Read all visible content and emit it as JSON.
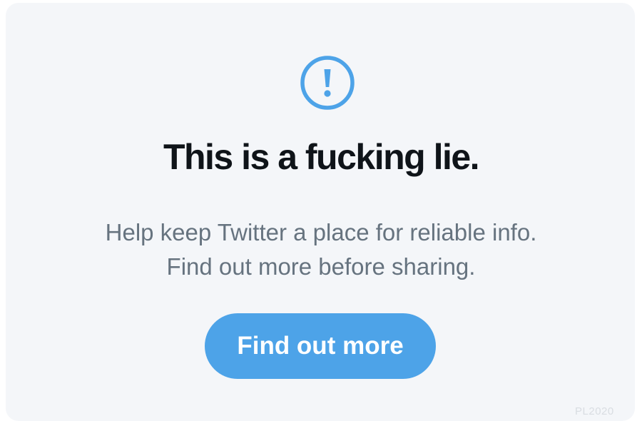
{
  "dialog": {
    "icon": "exclamation-circle-icon",
    "title": "This is a fucking lie.",
    "body_line_1": "Help keep Twitter a place for reliable info.",
    "body_line_2": "Find out more before sharing.",
    "button_label": "Find out more"
  },
  "watermark": "PL2020",
  "colors": {
    "card_background": "#f4f6f9",
    "accent_blue": "#4da3e8",
    "title_text": "#0f1419",
    "body_text": "#66737f"
  }
}
